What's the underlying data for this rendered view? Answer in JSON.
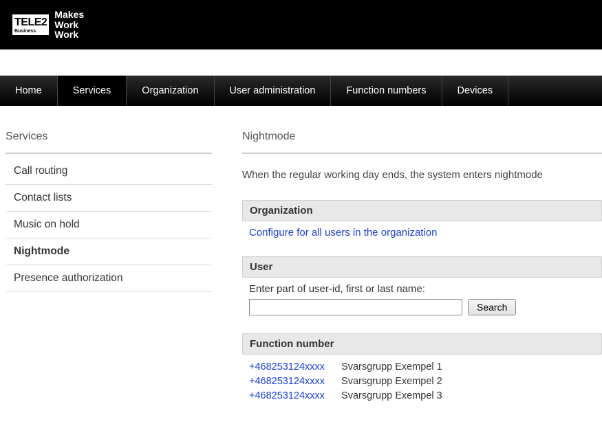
{
  "header": {
    "logo_main": "TELE2",
    "logo_sub": "Business",
    "tagline_lines": [
      "Makes",
      "Work",
      "Work"
    ]
  },
  "nav": [
    {
      "label": "Home"
    },
    {
      "label": "Services"
    },
    {
      "label": "Organization"
    },
    {
      "label": "User administration"
    },
    {
      "label": "Function numbers"
    },
    {
      "label": "Devices"
    }
  ],
  "sidebar": {
    "title": "Services",
    "items": [
      {
        "label": "Call routing"
      },
      {
        "label": "Contact lists"
      },
      {
        "label": "Music on hold"
      },
      {
        "label": "Nightmode"
      },
      {
        "label": "Presence authorization"
      }
    ]
  },
  "main": {
    "title": "Nightmode",
    "description": "When the regular working day ends, the system enters nightmode",
    "organization": {
      "header": "Organization",
      "link_text": "Configure for all users in the organization"
    },
    "user": {
      "header": "User",
      "field_label": "Enter part of user-id, first or last name:",
      "search_button": "Search"
    },
    "function_number": {
      "header": "Function number",
      "rows": [
        {
          "number": "+468253124xxxx",
          "name": "Svarsgrupp Exempel 1"
        },
        {
          "number": "+468253124xxxx",
          "name": "Svarsgrupp Exempel 2"
        },
        {
          "number": "+468253124xxxx",
          "name": "Svarsgrupp Exempel 3"
        }
      ]
    }
  }
}
